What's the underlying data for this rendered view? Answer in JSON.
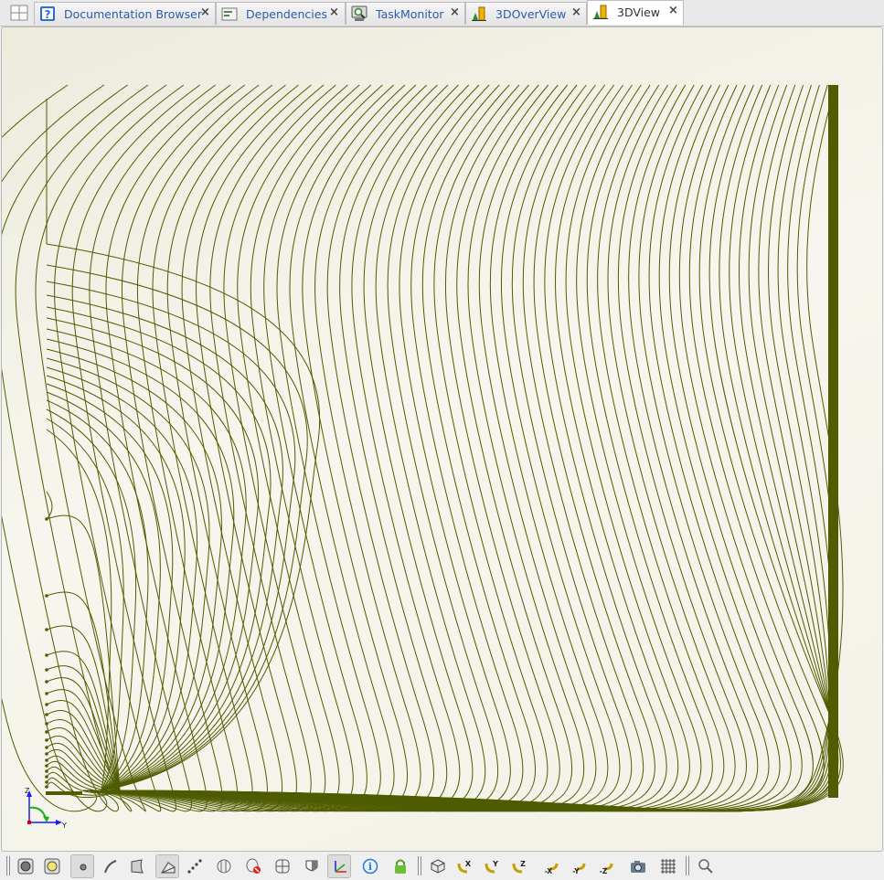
{
  "tabs": [
    {
      "label": "Documentation Browser",
      "icon": "help-icon",
      "active": false
    },
    {
      "label": "Dependencies",
      "icon": "dependencies-icon",
      "active": false
    },
    {
      "label": "TaskMonitor",
      "icon": "task-monitor-icon",
      "active": false
    },
    {
      "label": "3DOverView",
      "icon": "chart-icon",
      "active": false
    },
    {
      "label": "3DView",
      "icon": "chart-icon",
      "active": true
    }
  ],
  "close_glyph": "×",
  "view": {
    "background": "#f3f2e8",
    "line_color": "#4f5c00",
    "axis_triad": {
      "z": "Z",
      "y": "Y"
    }
  },
  "toolbar": {
    "buttons": [
      {
        "name": "display-mode-solid-icon"
      },
      {
        "name": "display-mode-highlight-icon"
      },
      {
        "name": "select-points-icon"
      },
      {
        "name": "select-curves-icon"
      },
      {
        "name": "select-surfaces-icon"
      },
      {
        "name": "select-faces-icon"
      },
      {
        "name": "select-vertices-icon"
      },
      {
        "name": "hidden-lines-icon"
      },
      {
        "name": "remove-hidden-icon"
      },
      {
        "name": "section-icon"
      },
      {
        "name": "shading-icon"
      },
      {
        "name": "axis-triad-icon"
      },
      {
        "name": "info-icon"
      },
      {
        "name": "lock-icon"
      },
      {
        "name": "isometric-view-icon"
      },
      {
        "name": "view-x-icon",
        "label": "X"
      },
      {
        "name": "view-y-icon",
        "label": "Y"
      },
      {
        "name": "view-z-icon",
        "label": "Z"
      },
      {
        "name": "view-neg-x-icon",
        "label": "-X"
      },
      {
        "name": "view-neg-y-icon",
        "label": "-Y"
      },
      {
        "name": "view-neg-z-icon",
        "label": "-Z"
      },
      {
        "name": "camera-icon"
      },
      {
        "name": "grid-icon"
      },
      {
        "name": "zoom-icon"
      }
    ]
  }
}
